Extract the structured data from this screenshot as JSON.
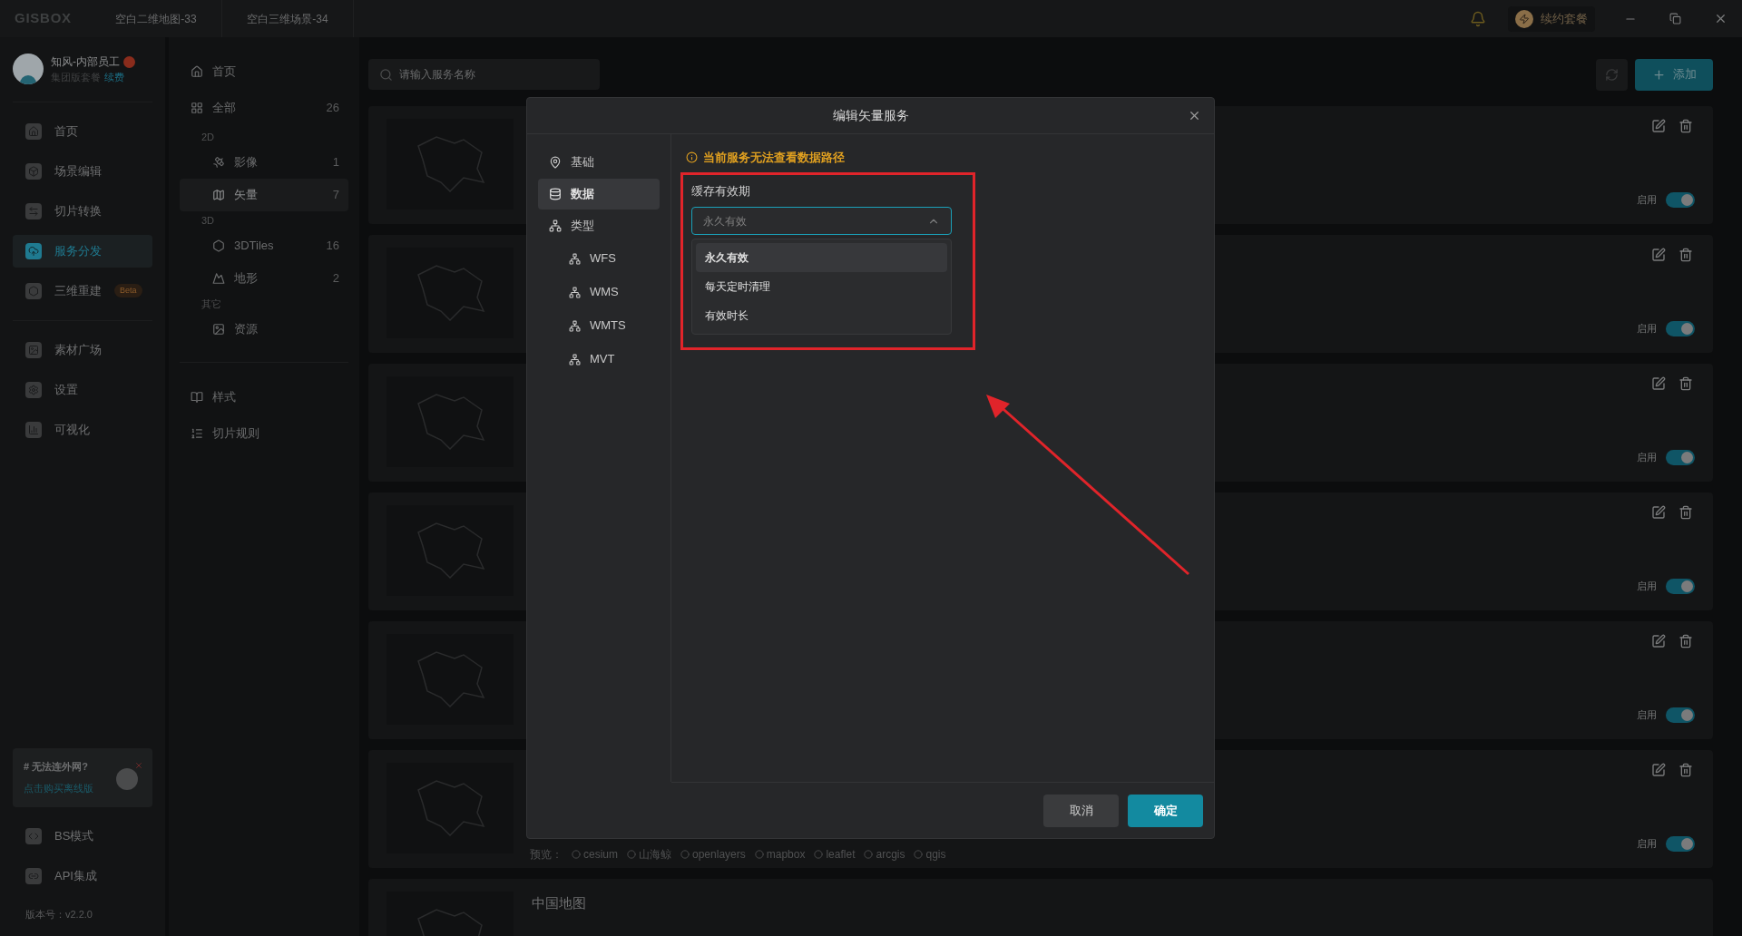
{
  "titlebar": {
    "logo": "GISBOX",
    "tabs": [
      {
        "label": "空白二维地图-33",
        "selected": false
      },
      {
        "label": "空白三维场景-34",
        "selected": false
      }
    ],
    "renew": "续约套餐"
  },
  "user": {
    "name": "知风-内部员工",
    "plan": "集团版套餐",
    "renew_link": "续费"
  },
  "nav_groups": [
    [
      {
        "label": "首页",
        "selected": false
      },
      {
        "label": "场景编辑",
        "selected": false
      },
      {
        "label": "切片转换",
        "selected": false
      },
      {
        "label": "服务分发",
        "selected": true
      },
      {
        "label": "三维重建",
        "selected": false,
        "badge": "Beta"
      }
    ],
    [
      {
        "label": "素材广场",
        "selected": false
      },
      {
        "label": "设置",
        "selected": false
      },
      {
        "label": "可视化",
        "selected": false
      }
    ]
  ],
  "promo": {
    "title": "# 无法连外网?",
    "link": "点击购买离线版"
  },
  "bottom_nav": [
    {
      "label": "BS模式"
    },
    {
      "label": "API集成"
    }
  ],
  "version": "版本号：v2.2.0",
  "categories": {
    "top": [
      {
        "kind": "item",
        "label": "首页",
        "selected": false
      },
      {
        "kind": "item",
        "label": "全部",
        "count": "26",
        "selected": false
      },
      {
        "kind": "heading",
        "label": "2D"
      },
      {
        "kind": "subitem",
        "label": "影像",
        "count": "1",
        "selected": false
      },
      {
        "kind": "subitem",
        "label": "矢量",
        "count": "7",
        "selected": true
      },
      {
        "kind": "heading",
        "label": "3D"
      },
      {
        "kind": "subitem",
        "label": "3DTiles",
        "count": "16",
        "selected": false
      },
      {
        "kind": "subitem",
        "label": "地形",
        "count": "2",
        "selected": false
      },
      {
        "kind": "heading",
        "label": "其它"
      },
      {
        "kind": "subitem",
        "label": "资源",
        "selected": false
      }
    ],
    "bottom": [
      {
        "label": "样式",
        "selected": false
      },
      {
        "label": "切片规则",
        "selected": false
      }
    ]
  },
  "search": {
    "placeholder": "请输入服务名称"
  },
  "add_button": "添加",
  "cards": [
    {
      "toggle_label": "启用",
      "on": true
    },
    {
      "toggle_label": "启用",
      "on": true
    },
    {
      "toggle_label": "启用",
      "on": true
    },
    {
      "toggle_label": "启用",
      "on": true
    },
    {
      "toggle_label": "启用",
      "on": true
    },
    {
      "toggle_label": "启用",
      "on": true,
      "preview_label": "预览：",
      "engines": [
        "cesium",
        "山海鲸",
        "openlayers",
        "mapbox",
        "leaflet",
        "arcgis",
        "qgis"
      ]
    },
    {
      "title": "中国地图"
    }
  ],
  "modal": {
    "title": "编辑矢量服务",
    "nav": [
      {
        "label": "基础",
        "selected": false
      },
      {
        "label": "数据",
        "selected": true
      },
      {
        "label": "类型",
        "selected": false,
        "children": [
          {
            "label": "WFS"
          },
          {
            "label": "WMS"
          },
          {
            "label": "WMTS"
          },
          {
            "label": "MVT"
          }
        ]
      }
    ],
    "warning": "当前服务无法查看数据路径",
    "field_label": "缓存有效期",
    "select": {
      "value": "永久有效",
      "expanded": true,
      "options": [
        {
          "label": "永久有效",
          "selected": true
        },
        {
          "label": "每天定时清理",
          "selected": false
        },
        {
          "label": "有效时长",
          "selected": false
        }
      ]
    },
    "cancel": "取消",
    "ok": "确定"
  }
}
